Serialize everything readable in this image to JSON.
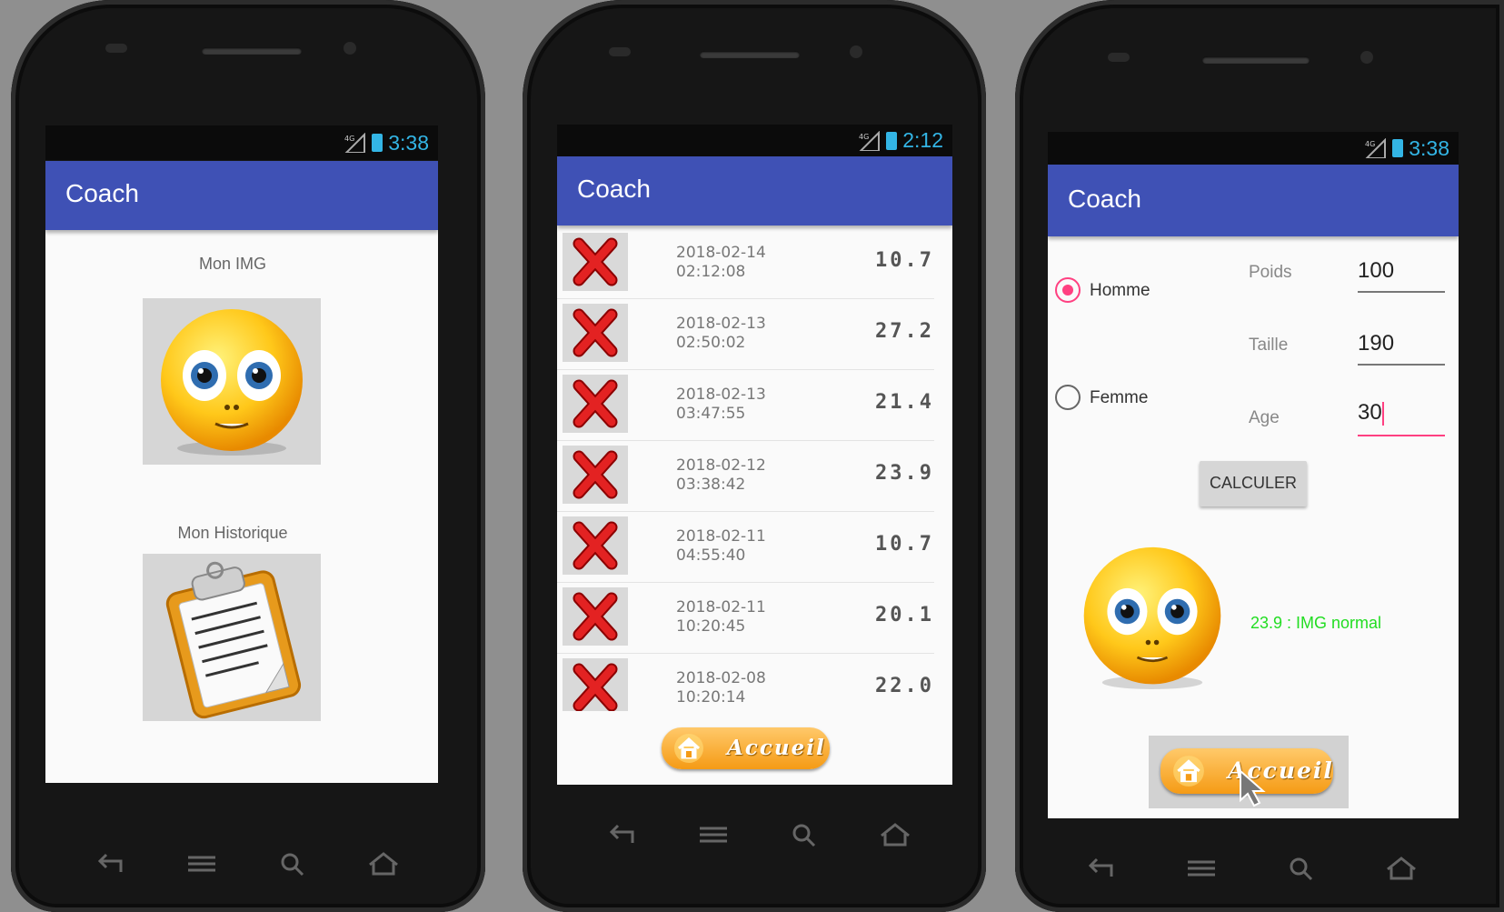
{
  "phone1": {
    "status_time": "3:38",
    "network": "4G",
    "app_title": "Coach",
    "img_label": "Mon IMG",
    "history_label": "Mon Historique"
  },
  "phone2": {
    "status_time": "2:12",
    "network": "4G",
    "app_title": "Coach",
    "history": [
      {
        "date": "2018-02-14",
        "time": "02:12:08",
        "value": "10.7"
      },
      {
        "date": "2018-02-13",
        "time": "02:50:02",
        "value": "27.2"
      },
      {
        "date": "2018-02-13",
        "time": "03:47:55",
        "value": "21.4"
      },
      {
        "date": "2018-02-12",
        "time": "03:38:42",
        "value": "23.9"
      },
      {
        "date": "2018-02-11",
        "time": "04:55:40",
        "value": "10.7"
      },
      {
        "date": "2018-02-11",
        "time": "10:20:45",
        "value": "20.1"
      },
      {
        "date": "2018-02-08",
        "time": "10:20:14",
        "value": "22.0"
      }
    ],
    "home_button": "Accueil"
  },
  "phone3": {
    "status_time": "3:38",
    "network": "4G",
    "app_title": "Coach",
    "radio_homme": "Homme",
    "radio_femme": "Femme",
    "selected_gender": "Homme",
    "poids_label": "Poids",
    "poids_value": "100",
    "taille_label": "Taille",
    "taille_value": "190",
    "age_label": "Age",
    "age_value": "30",
    "calculate_button": "CALCULER",
    "result_text": "23.9 : IMG normal",
    "home_button": "Accueil"
  },
  "colors": {
    "appbar": "#3f51b5",
    "accent": "#ff4081",
    "result": "#22dd22",
    "status_icons": "#33b5e5",
    "home_button": "#f7a325"
  },
  "icons": [
    "signal-icon",
    "battery-icon",
    "back-nav-icon",
    "menu-nav-icon",
    "search-nav-icon",
    "home-nav-icon",
    "delete-x-icon",
    "smiley-icon",
    "clipboard-icon",
    "house-icon"
  ]
}
